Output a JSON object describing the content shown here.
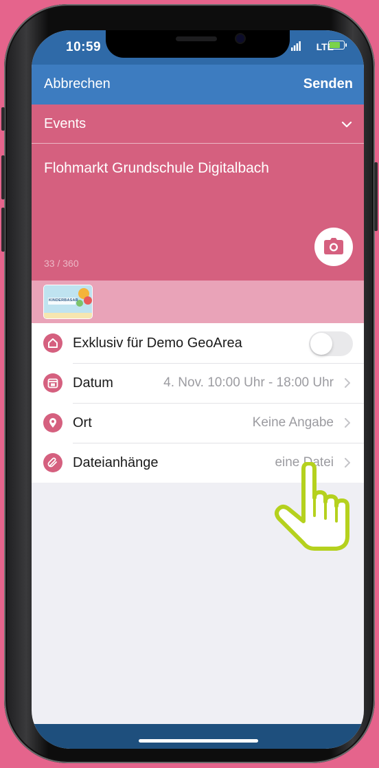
{
  "status": {
    "time": "10:59",
    "network": "LTE"
  },
  "navbar": {
    "cancel_label": "Abbrechen",
    "send_label": "Senden"
  },
  "composer": {
    "category": "Events",
    "text": "Flohmarkt Grundschule Digitalbach",
    "counter": "33 / 360",
    "attachment_thumb_text": "KINDERBASAR"
  },
  "rows": [
    {
      "label": "Exklusiv für Demo GeoArea",
      "icon": "home-icon",
      "toggle_on": false
    },
    {
      "label": "Datum",
      "value": "4. Nov. 10:00 Uhr - 18:00 Uhr",
      "icon": "calendar-icon"
    },
    {
      "label": "Ort",
      "value": "Keine Angabe",
      "icon": "location-pin-icon"
    },
    {
      "label": "Dateianhänge",
      "value": "eine Datei",
      "icon": "paperclip-icon"
    }
  ],
  "colors": {
    "accent": "#d5607f",
    "navbar": "#3d7cc0",
    "status": "#2f6aa8",
    "background": "#e5648c",
    "pointer": "#b5d11e"
  }
}
